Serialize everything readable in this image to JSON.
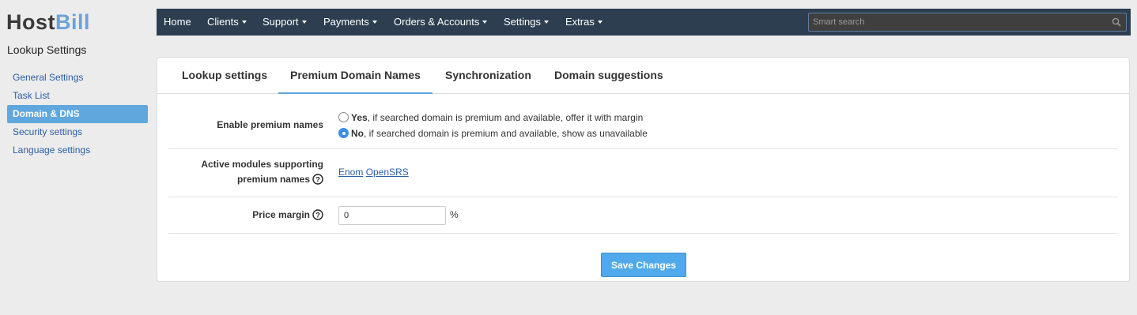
{
  "brand": {
    "part1": "Host",
    "part2": "Bill"
  },
  "sidebar": {
    "title": "Lookup Settings",
    "items": [
      {
        "label": "General Settings",
        "active": false
      },
      {
        "label": "Task List",
        "active": false
      },
      {
        "label": "Domain & DNS",
        "active": true
      },
      {
        "label": "Security settings",
        "active": false
      },
      {
        "label": "Language settings",
        "active": false
      }
    ]
  },
  "topnav": {
    "items": [
      {
        "label": "Home",
        "dropdown": false
      },
      {
        "label": "Clients",
        "dropdown": true
      },
      {
        "label": "Support",
        "dropdown": true
      },
      {
        "label": "Payments",
        "dropdown": true
      },
      {
        "label": "Orders & Accounts",
        "dropdown": true
      },
      {
        "label": "Settings",
        "dropdown": true
      },
      {
        "label": "Extras",
        "dropdown": true
      }
    ],
    "search_placeholder": "Smart search"
  },
  "tabs": [
    {
      "label": "Lookup settings",
      "active": false
    },
    {
      "label": "Premium Domain Names",
      "active": true
    },
    {
      "label": "Synchronization",
      "active": false
    },
    {
      "label": "Domain suggestions",
      "active": false
    }
  ],
  "form": {
    "enable_premium": {
      "label": "Enable premium names",
      "options": [
        {
          "bold": "Yes",
          "text": ", if searched domain is premium and available, offer it with margin",
          "checked": false
        },
        {
          "bold": "No",
          "text": ", if searched domain is premium and available, show as unavailable",
          "checked": true
        }
      ]
    },
    "active_modules": {
      "label_line1": "Active modules supporting",
      "label_line2": "premium names",
      "modules": [
        "Enom",
        "OpenSRS"
      ]
    },
    "price_margin": {
      "label": "Price margin",
      "value": "0",
      "unit": "%"
    },
    "save_label": "Save Changes"
  },
  "icons": {
    "help": "question-circle-icon",
    "search": "magnifier-icon",
    "caret": "caret-down-icon"
  },
  "colors": {
    "accent": "#5fa7dd",
    "nav_bg": "#2c3e50",
    "button": "#4fa9ea",
    "link": "#2b5ea6"
  }
}
